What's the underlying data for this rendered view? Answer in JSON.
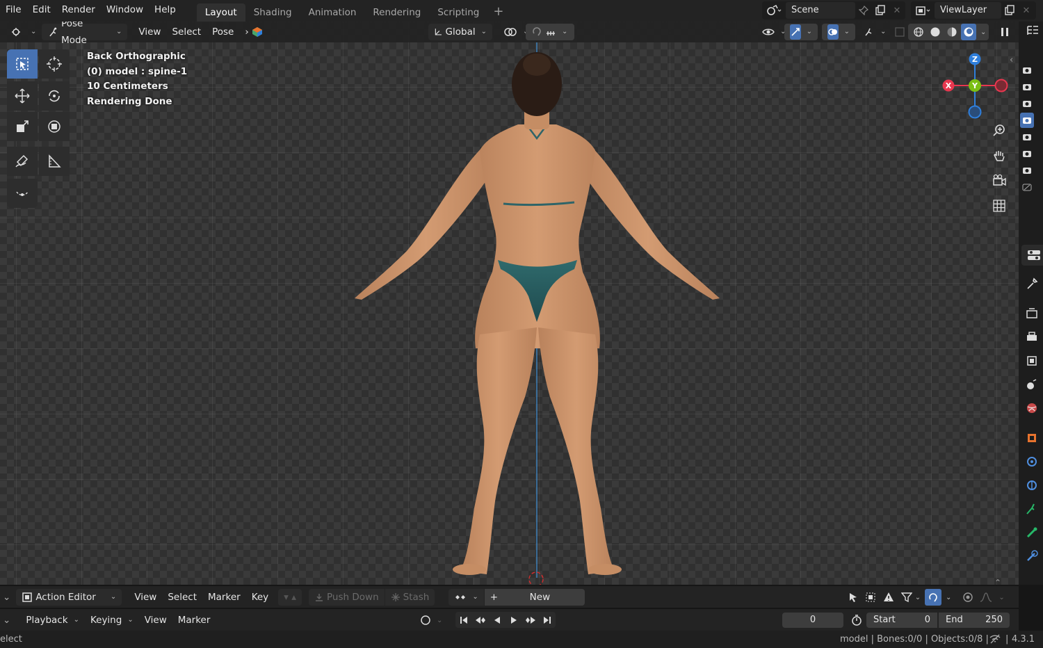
{
  "menu": [
    "File",
    "Edit",
    "Render",
    "Window",
    "Help"
  ],
  "workspace_tabs": [
    {
      "label": "Layout",
      "active": true
    },
    {
      "label": "Shading",
      "active": false
    },
    {
      "label": "Animation",
      "active": false
    },
    {
      "label": "Rendering",
      "active": false
    },
    {
      "label": "Scripting",
      "active": false
    }
  ],
  "scene": {
    "label": "Scene"
  },
  "view_layer": {
    "label": "ViewLayer"
  },
  "viewport_header": {
    "mode": "Pose Mode",
    "menus": [
      "View",
      "Select",
      "Pose"
    ],
    "transform_orientation": "Global"
  },
  "viewport_overlay": {
    "lines": [
      "Back Orthographic",
      "(0) model : spine-1",
      "10 Centimeters",
      "Rendering Done"
    ]
  },
  "gizmo": {
    "z": "Z",
    "y": "Y",
    "x": "X",
    "colors": {
      "x": "#e8374f",
      "y": "#7bbf14",
      "z": "#2f7fdc"
    }
  },
  "action_editor": {
    "editor_label": "Action Editor",
    "menus": [
      "View",
      "Select",
      "Marker",
      "Key"
    ],
    "push_down": "Push Down",
    "stash": "Stash",
    "new_label": "New"
  },
  "timeline": {
    "menus": [
      "Playback",
      "Keying",
      "View",
      "Marker"
    ],
    "current_frame": "0",
    "start_label": "Start",
    "start_value": "0",
    "end_label": "End",
    "end_value": "250"
  },
  "statusbar": {
    "left": "elect",
    "right": "model | Bones:0/0 | Objects:0/8 |",
    "version": "4.3.1"
  },
  "colors": {
    "accent": "#4772b3",
    "bg": "#303030"
  }
}
